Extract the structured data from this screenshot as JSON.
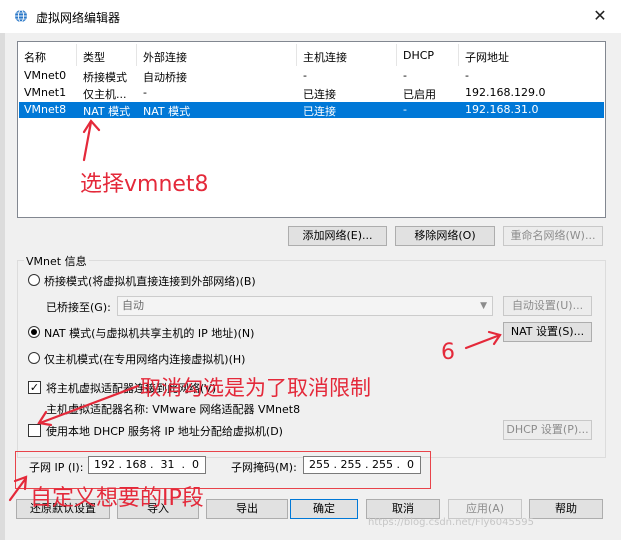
{
  "window": {
    "title": "虚拟网络编辑器",
    "close_glyph": "✕"
  },
  "network_list": {
    "columns": [
      "名称",
      "类型",
      "外部连接",
      "主机连接",
      "DHCP",
      "子网地址"
    ],
    "rows": [
      {
        "name": "VMnet0",
        "type": "桥接模式",
        "external": "自动桥接",
        "host": "-",
        "dhcp": "-",
        "subnet": "-"
      },
      {
        "name": "VMnet1",
        "type": "仅主机...",
        "external": "-",
        "host": "已连接",
        "dhcp": "已启用",
        "subnet": "192.168.129.0"
      },
      {
        "name": "VMnet8",
        "type": "NAT 模式",
        "external": "NAT 模式",
        "host": "已连接",
        "dhcp": "-",
        "subnet": "192.168.31.0"
      }
    ],
    "selected_index": 2
  },
  "list_buttons": {
    "add": "添加网络(E)...",
    "remove": "移除网络(O)",
    "rename": "重命名网络(W)..."
  },
  "vmnet_info": {
    "title": "VMnet 信息",
    "bridged_label": "桥接模式(将虚拟机直接连接到外部网络)(B)",
    "bridged_to_label": "已桥接至(G):",
    "bridged_to_value": "自动",
    "auto_settings": "自动设置(U)...",
    "nat_label": "NAT 模式(与虚拟机共享主机的 IP 地址)(N)",
    "nat_settings": "NAT 设置(S)...",
    "hostonly_label": "仅主机模式(在专用网络内连接虚拟机)(H)",
    "connect_adapter_label": "将主机虚拟适配器连接到此网络(V)",
    "adapter_name_label": "主机虚拟适配器名称: VMware 网络适配器 VMnet8",
    "dhcp_label": "使用本地 DHCP 服务将 IP 地址分配给虚拟机(D)",
    "dhcp_settings": "DHCP 设置(P)...",
    "selected_mode": "nat",
    "connect_adapter_checked": true,
    "dhcp_checked": false
  },
  "subnet": {
    "ip_label": "子网 IP (I):",
    "ip_value": "192 . 168 .  31  .  0",
    "mask_label": "子网掩码(M):",
    "mask_value": "255 . 255 . 255 .  0"
  },
  "footer": {
    "restore": "还原默认设置",
    "import": "导入",
    "export": "导出",
    "ok": "确定",
    "cancel": "取消",
    "apply": "应用(A)",
    "help": "帮助"
  },
  "annotations": {
    "select_vmnet8": "选择vmnet8",
    "step_six": "6",
    "uncheck_dhcp": "取消勾选是为了取消限制",
    "custom_ip": "自定义想要的IP段"
  },
  "watermark": "https://blog.csdn.net/Fly6045595",
  "colors": {
    "selection": "#0078d7",
    "annotation": "#e4293a"
  }
}
